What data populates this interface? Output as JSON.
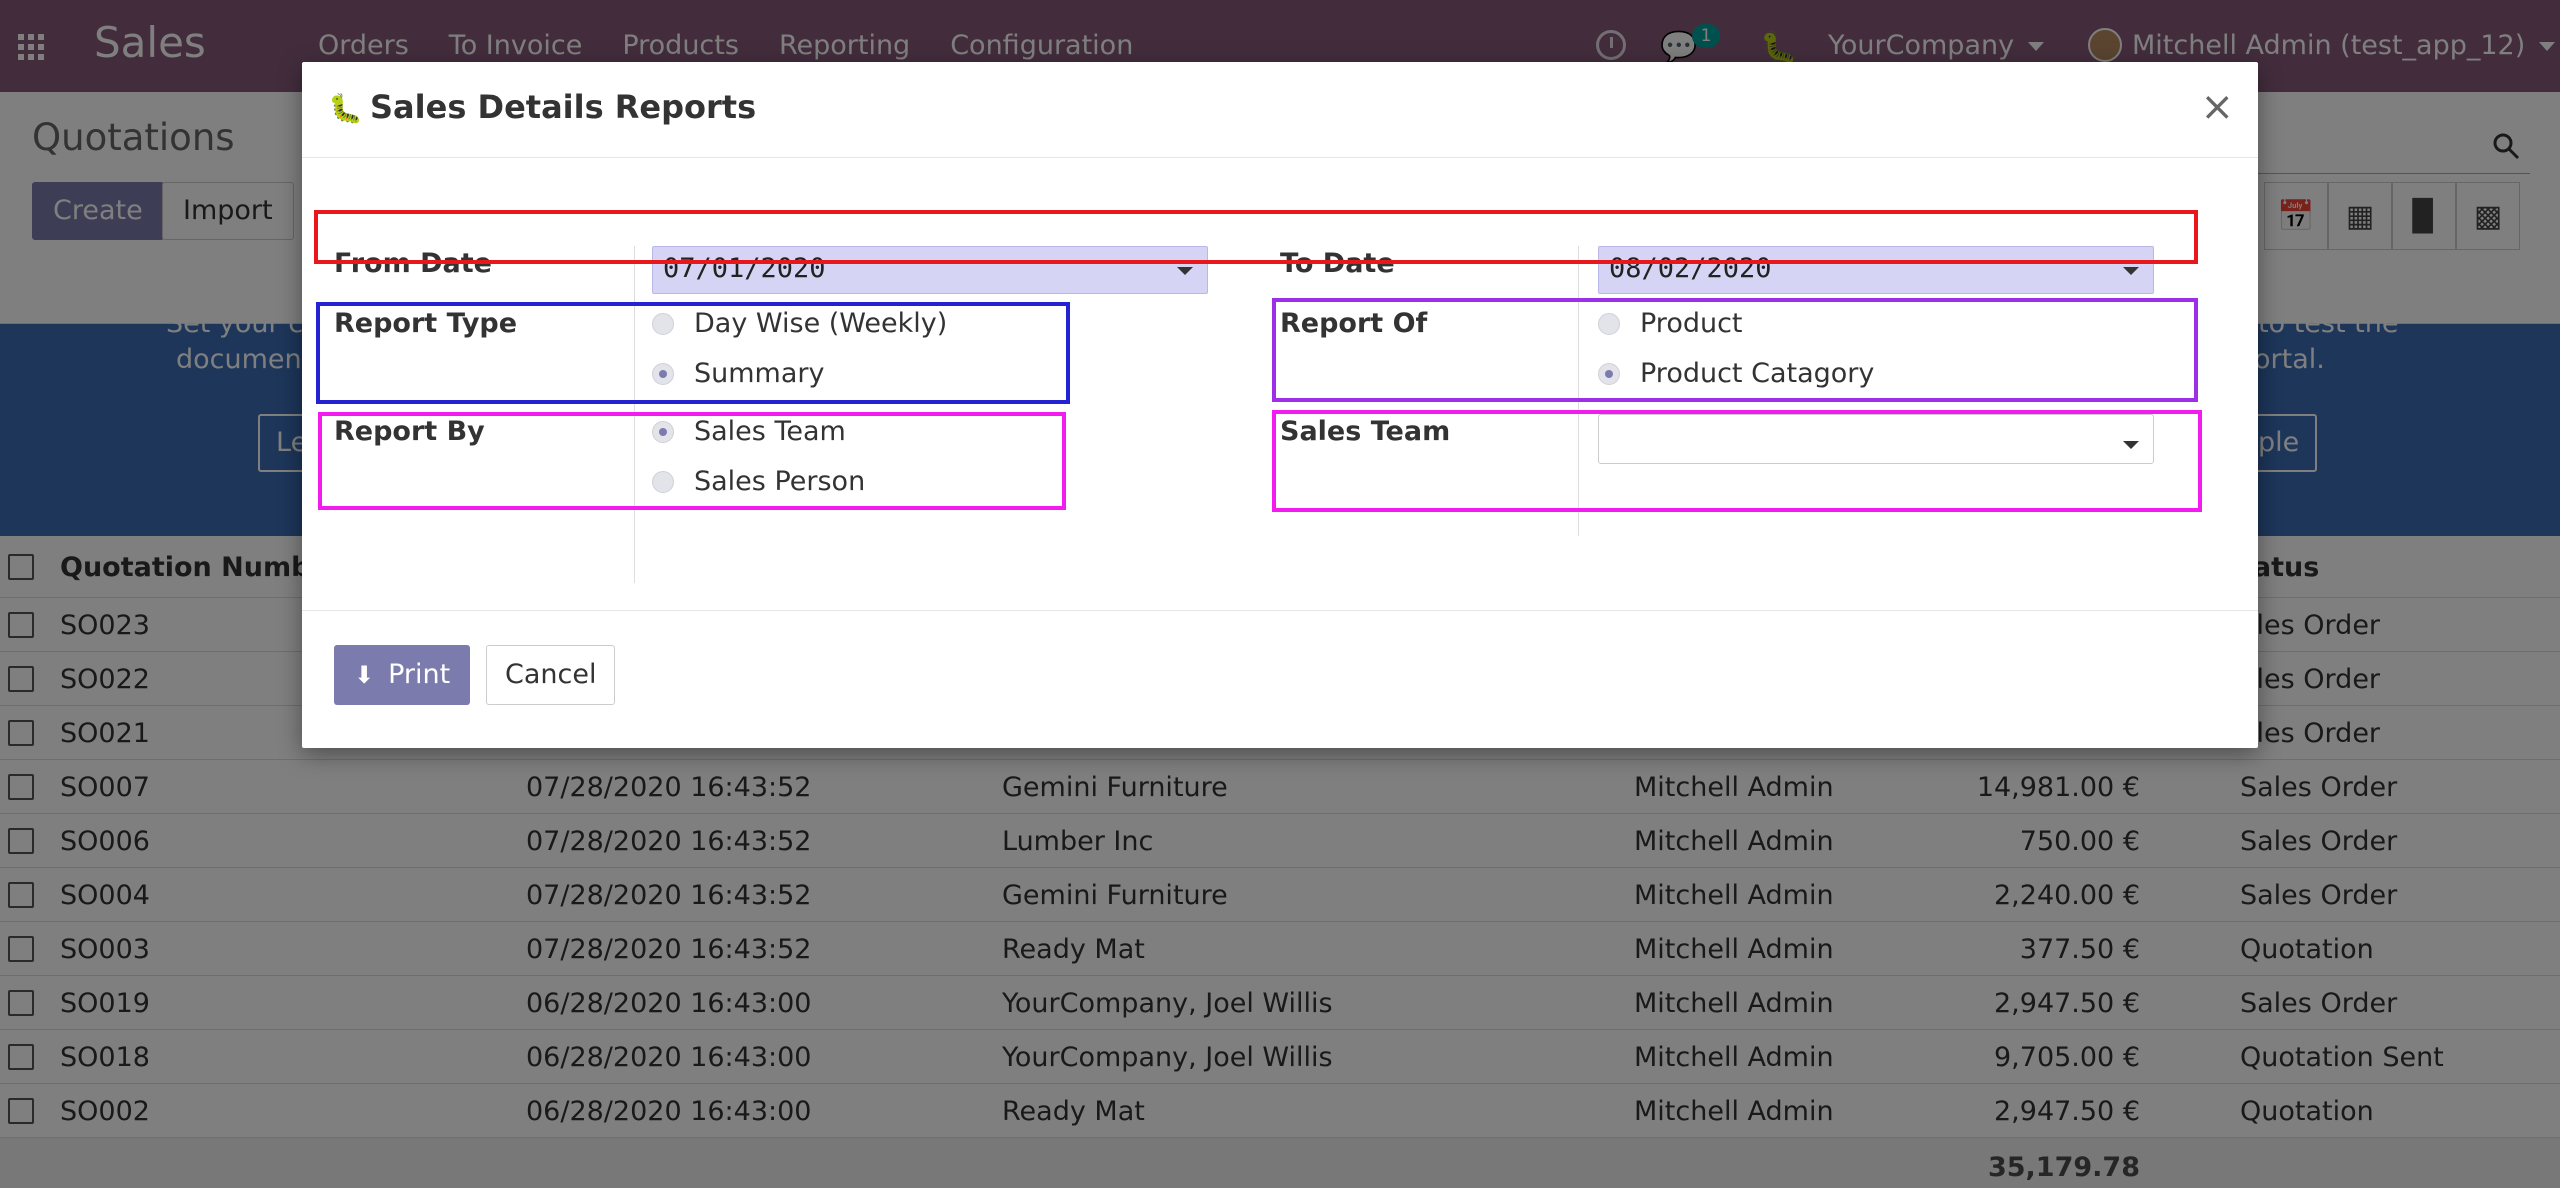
{
  "navbar": {
    "brand": "Sales",
    "menu": [
      "Orders",
      "To Invoice",
      "Products",
      "Reporting",
      "Configuration"
    ],
    "chat_badge": "1",
    "company": "YourCompany",
    "user": "Mitchell Admin (test_app_12)"
  },
  "control": {
    "title": "Quotations",
    "create_label": "Create",
    "import_label": "Import"
  },
  "banner": {
    "text_left_1": "Set your co",
    "text_left_2": "document",
    "text_right_1": "to test the",
    "text_right_2": "ortal.",
    "btn_left": "Le",
    "btn_right": "ple"
  },
  "list": {
    "headers": {
      "number": "Quotation Numbe",
      "status": "tatus"
    },
    "rows": [
      {
        "number": "SO023",
        "date": "",
        "customer": "",
        "salesperson": "",
        "total": "",
        "status": "ales Order"
      },
      {
        "number": "SO022",
        "date": "",
        "customer": "",
        "salesperson": "",
        "total": "",
        "status": "ales Order"
      },
      {
        "number": "SO021",
        "date": "",
        "customer": "",
        "salesperson": "",
        "total": "",
        "status": "ales Order"
      },
      {
        "number": "SO007",
        "date": "07/28/2020 16:43:52",
        "customer": "Gemini Furniture",
        "salesperson": "Mitchell Admin",
        "total": "14,981.00 €",
        "status": "Sales Order"
      },
      {
        "number": "SO006",
        "date": "07/28/2020 16:43:52",
        "customer": "Lumber Inc",
        "salesperson": "Mitchell Admin",
        "total": "750.00 €",
        "status": "Sales Order"
      },
      {
        "number": "SO004",
        "date": "07/28/2020 16:43:52",
        "customer": "Gemini Furniture",
        "salesperson": "Mitchell Admin",
        "total": "2,240.00 €",
        "status": "Sales Order"
      },
      {
        "number": "SO003",
        "date": "07/28/2020 16:43:52",
        "customer": "Ready Mat",
        "salesperson": "Mitchell Admin",
        "total": "377.50 €",
        "status": "Quotation"
      },
      {
        "number": "SO019",
        "date": "06/28/2020 16:43:00",
        "customer": "YourCompany, Joel Willis",
        "salesperson": "Mitchell Admin",
        "total": "2,947.50 €",
        "status": "Sales Order"
      },
      {
        "number": "SO018",
        "date": "06/28/2020 16:43:00",
        "customer": "YourCompany, Joel Willis",
        "salesperson": "Mitchell Admin",
        "total": "9,705.00 €",
        "status": "Quotation Sent"
      },
      {
        "number": "SO002",
        "date": "06/28/2020 16:43:00",
        "customer": "Ready Mat",
        "salesperson": "Mitchell Admin",
        "total": "2,947.50 €",
        "status": "Quotation"
      }
    ],
    "sum_total": "35,179.78"
  },
  "dialog": {
    "title": "Sales Details Reports",
    "from_date_label": "From Date",
    "from_date_value": "07/01/2020",
    "to_date_label": "To Date",
    "to_date_value": "08/02/2020",
    "report_type_label": "Report Type",
    "report_type_options": [
      "Day Wise (Weekly)",
      "Summary"
    ],
    "report_type_selected": "Summary",
    "report_of_label": "Report Of",
    "report_of_options": [
      "Product",
      "Product Catagory"
    ],
    "report_of_selected": "Product Catagory",
    "report_by_label": "Report By",
    "report_by_options": [
      "Sales Team",
      "Sales Person"
    ],
    "report_by_selected": "Sales Team",
    "sales_team_label": "Sales Team",
    "sales_team_value": "",
    "print_label": "Print",
    "cancel_label": "Cancel"
  },
  "colors": {
    "navbar": "#875a7b",
    "primary": "#7c7bad",
    "banner": "#3a6cb5",
    "date_field": "#d5d4f5",
    "highlight_red": "#e8171c",
    "highlight_blue": "#2323d4",
    "highlight_purple": "#9d2fe6",
    "highlight_magenta": "#f21bf0"
  }
}
